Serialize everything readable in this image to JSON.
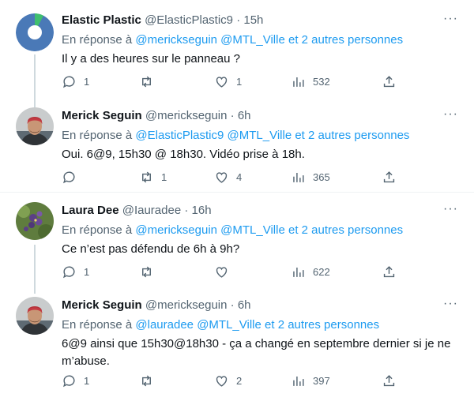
{
  "tweets": [
    {
      "name": "Elastic Plastic",
      "handle": "@ElasticPlastic9",
      "sep": "·",
      "time": "15h",
      "reply_prefix": "En réponse à",
      "mention1": "@merickseguin",
      "mention2": "@MTL_Ville",
      "mention3": "et 2 autres personnes",
      "text": "Il y a des heures sur le panneau ?",
      "replies": "1",
      "retweets": "",
      "likes": "1",
      "views": "532",
      "more": "···"
    },
    {
      "name": "Merick Seguin",
      "handle": "@merickseguin",
      "sep": "·",
      "time": "6h",
      "reply_prefix": "En réponse à",
      "mention1": "@ElasticPlastic9",
      "mention2": "@MTL_Ville",
      "mention3": "et 2 autres personnes",
      "text": "Oui. 6@9, 15h30 @ 18h30. Vidéo prise à 18h.",
      "replies": "",
      "retweets": "1",
      "likes": "4",
      "views": "365",
      "more": "···"
    },
    {
      "name": "Laura Dee",
      "handle": "@Iauradee",
      "sep": "·",
      "time": "16h",
      "reply_prefix": "En réponse à",
      "mention1": "@merickseguin",
      "mention2": "@MTL_Ville",
      "mention3": "et 2 autres personnes",
      "text": "Ce n’est pas défendu de 6h à 9h?",
      "replies": "1",
      "retweets": "",
      "likes": "",
      "views": "622",
      "more": "···"
    },
    {
      "name": "Merick Seguin",
      "handle": "@merickseguin",
      "sep": "·",
      "time": "6h",
      "reply_prefix": "En réponse à",
      "mention1": "@lauradee",
      "mention2": "@MTL_Ville",
      "mention3": "et 2 autres personnes",
      "text": "6@9 ainsi que 15h30@18h30 - ça a changé en septembre dernier si je ne m’abuse.",
      "replies": "1",
      "retweets": "",
      "likes": "2",
      "views": "397",
      "more": "···"
    }
  ],
  "icons": {
    "reply": "reply-icon",
    "retweet": "retweet-icon",
    "like": "heart-icon",
    "views": "views-icon",
    "share": "share-icon"
  },
  "colors": {
    "link": "#1d9bf0",
    "muted": "#536471",
    "text": "#0f1419",
    "thread_line": "#cfd9de",
    "pie_blue": "#4a79b7",
    "pie_green": "#3fbf6e"
  }
}
